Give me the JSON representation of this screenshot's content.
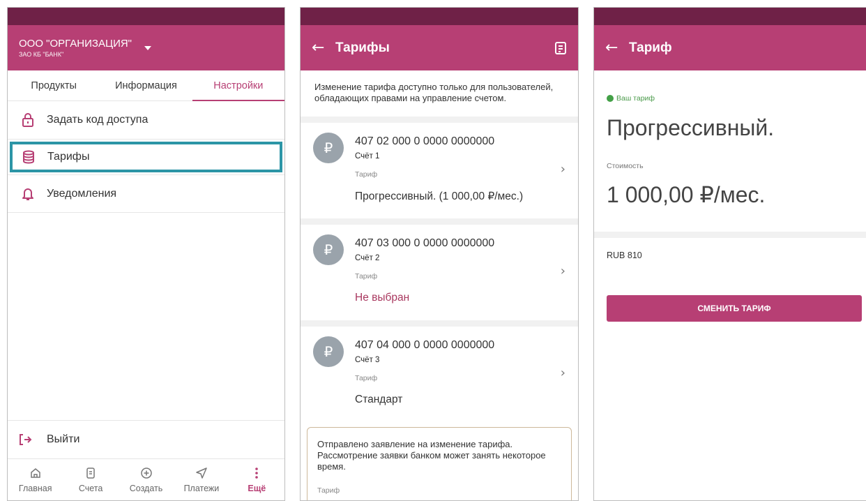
{
  "panel1": {
    "org_title": "ООО \"ОРГАНИЗАЦИЯ\"",
    "org_subtitle": "ЗАО КБ \"БАНК\"",
    "tabs": [
      {
        "label": "Продукты"
      },
      {
        "label": "Информация"
      },
      {
        "label": "Настройки"
      }
    ],
    "menu": [
      {
        "label": "Задать код доступа",
        "icon": "lock-icon"
      },
      {
        "label": "Тарифы",
        "icon": "database-icon"
      },
      {
        "label": "Уведомления",
        "icon": "bell-icon"
      }
    ],
    "logout_label": "Выйти",
    "nav": [
      {
        "label": "Главная",
        "icon": "home-icon"
      },
      {
        "label": "Счета",
        "icon": "document-icon"
      },
      {
        "label": "Создать",
        "icon": "plus-circle-icon"
      },
      {
        "label": "Платежи",
        "icon": "send-icon"
      },
      {
        "label": "Ещё",
        "icon": "more-vertical-icon"
      }
    ]
  },
  "panel2": {
    "title": "Тарифы",
    "info_text": "Изменение тарифа доступно только для пользователей, обладающих правами на управление счетом.",
    "accounts": [
      {
        "number": "407 02 000 0 0000 0000000",
        "name": "Счёт 1",
        "tariff_label": "Тариф",
        "tariff_value": "Прогрессивный. (1 000,00 ₽/мес.)"
      },
      {
        "number": "407 03 000 0 0000 0000000",
        "name": "Счёт 2",
        "tariff_label": "Тариф",
        "tariff_value": "Не выбран"
      },
      {
        "number": "407 04 000 0 0000 0000000",
        "name": "Счёт 3",
        "tariff_label": "Тариф",
        "tariff_value": "Стандарт"
      }
    ],
    "avatar_symbol": "₽",
    "notice_text": "Отправлено заявление на изменение тарифа. Рассмотрение заявки банком может занять некоторое время.",
    "notice_label": "Тариф"
  },
  "panel3": {
    "title": "Тариф",
    "your_tariff_label": "Ваш тариф",
    "plan_name": "Прогрессивный.",
    "cost_label": "Стоимость",
    "cost_value": "1 000,00 ₽/мес.",
    "currency": "RUB 810",
    "change_button": "СМЕНИТЬ ТАРИФ"
  },
  "colors": {
    "appbar": "#b73f74",
    "statusbar": "#6f2147",
    "highlight": "#2c95a6",
    "accent": "#b73f74"
  }
}
